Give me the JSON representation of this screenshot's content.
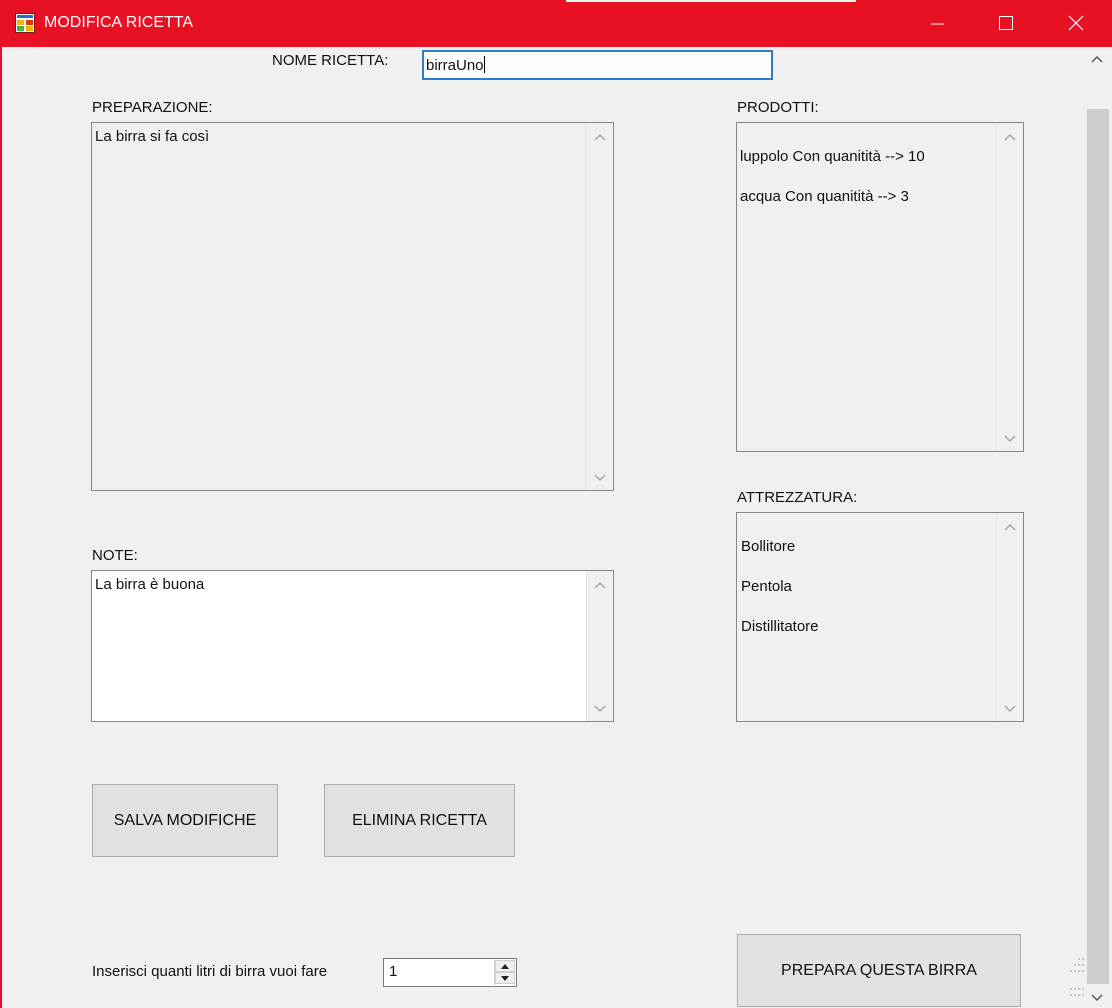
{
  "window": {
    "title": "MODIFICA RICETTA",
    "accent_color": "#e81123",
    "app_icon": "form-app-icon",
    "controls": [
      "minimize-icon",
      "maximize-icon",
      "close-icon"
    ]
  },
  "form": {
    "name_label": "NOME RICETTA:",
    "name_value": "birraUno",
    "preparation_label": "PREPARAZIONE:",
    "preparation_text": "La birra si fa così",
    "notes_label": "NOTE:",
    "notes_text": "La birra è buona",
    "products_label": "PRODOTTI:",
    "products_items": [
      "luppolo Con quanitità --> 10",
      "acqua Con quanitità --> 3"
    ],
    "equipment_label": "ATTREZZATURA:",
    "equipment_items": [
      "Bollitore",
      "Pentola",
      "Distillitatore"
    ],
    "save_button": "SALVA MODIFICHE",
    "delete_button": "ELIMINA RICETTA",
    "liters_label": "Inserisci quanti litri di birra vuoi fare",
    "liters_value": "1",
    "brew_button": "PREPARA QUESTA BIRRA"
  }
}
